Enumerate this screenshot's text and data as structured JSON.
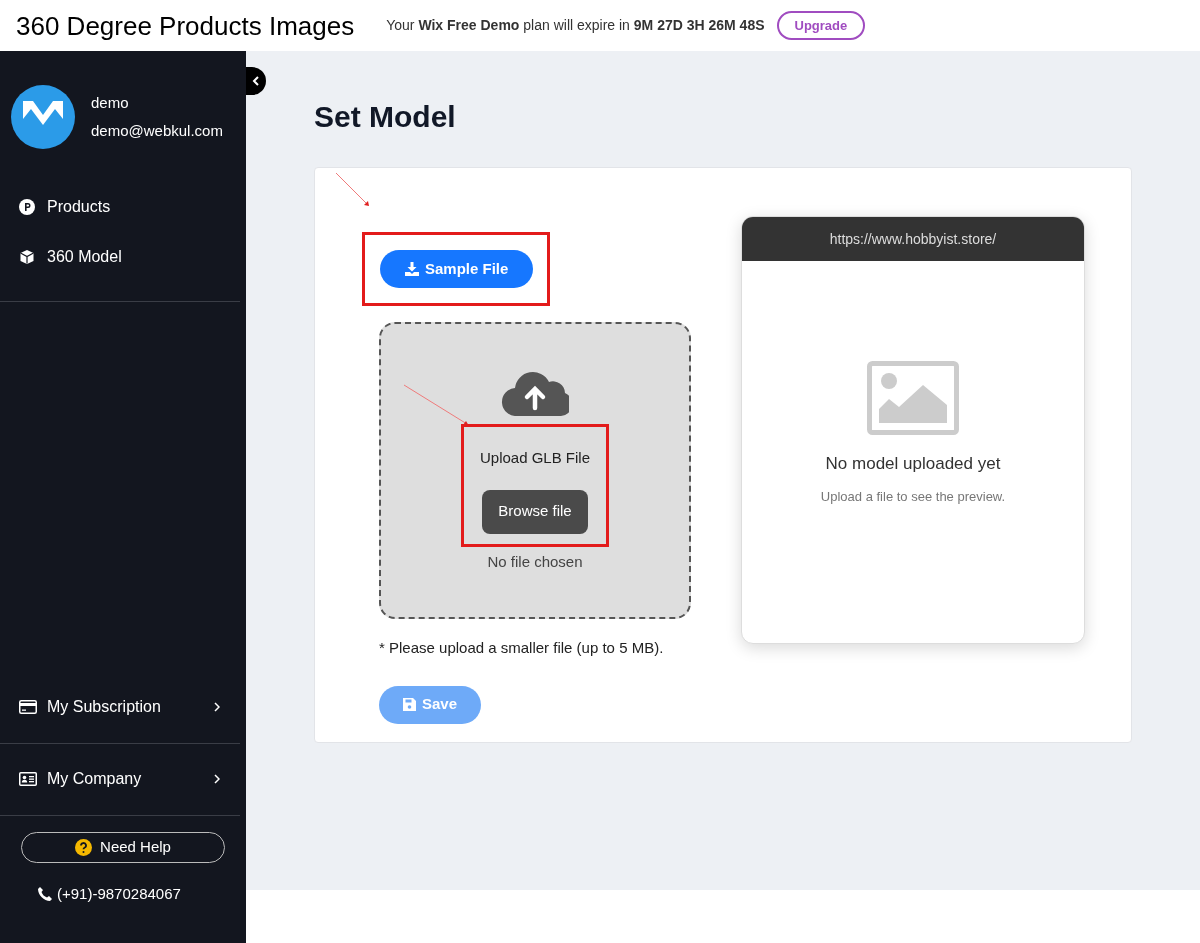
{
  "header": {
    "title": "360 Degree Products Images",
    "banner": "Your **Wix Free Demo** plan will expire in **9M 27D 3H 26M 48S**",
    "upgrade": "Upgrade"
  },
  "sidebar": {
    "user": {
      "name": "demo",
      "email": "demo@webkul.com"
    },
    "items": [
      {
        "label": "Products",
        "kind": "products"
      },
      {
        "label": "360 Model",
        "kind": "model"
      }
    ],
    "bottom_items": [
      {
        "label": "My Subscription",
        "kind": "card"
      },
      {
        "label": "My Company",
        "kind": "company"
      }
    ],
    "help": "Need Help",
    "phone": "(+91)-9870284067"
  },
  "page": {
    "title": "Set Model",
    "sample_button": "Sample File",
    "upload_label": "Upload GLB File",
    "browse_button": "Browse file",
    "file_status": "No file chosen",
    "note": "* Please upload a smaller file (up to 5 MB).",
    "save_button": "Save",
    "save_disabled": true,
    "preview": {
      "url": "https://www.hobbyist.store/",
      "empty_title": "No model uploaded yet",
      "empty_text": "Upload a file to see the preview."
    }
  }
}
